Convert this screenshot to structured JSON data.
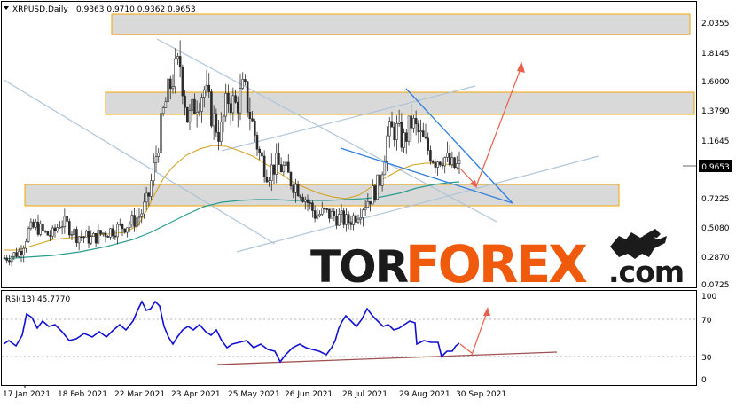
{
  "header": {
    "symbol": "XRPUSD,Daily",
    "ohlc": "0.9363 0.9710 0.9362 0.9653"
  },
  "price_axis": {
    "ticks": [
      "2.0355",
      "1.8145",
      "1.6000",
      "1.3790",
      "1.1645",
      "0.9653",
      "0.7225",
      "0.5080",
      "0.2870",
      "0.0725"
    ],
    "current_price": "0.9653"
  },
  "rsi": {
    "label": "RSI(13) 45.7770",
    "ticks": [
      "100",
      "70",
      "30",
      "0"
    ]
  },
  "dates": [
    "17 Jan 2021",
    "18 Feb 2021",
    "22 Mar 2021",
    "23 Apr 2021",
    "25 May 2021",
    "26 Jun 2021",
    "28 Jul 2021",
    "29 Aug 2021",
    "30 Sep 2021"
  ],
  "watermark": {
    "part1": "TOR",
    "part2": "FOREX",
    "part3": ".com"
  },
  "colors": {
    "bull_candle": "#2b2b2b",
    "bear_candle": "#2b2b2b",
    "ma_fast": "#d4a017",
    "ma_slow": "#2a9d8f",
    "zone_fill": "#d9d9d9",
    "zone_border": "#f0a500",
    "channel": "#b0c4d8",
    "triangle": "#2f7fe0",
    "arrow": "#e8604c",
    "rsi_line": "#1010d0",
    "rsi_support": "#a05050",
    "watermark_dark": "#1b1b1b",
    "watermark_orange": "#f05a0c"
  },
  "chart_data": {
    "type": "candlestick",
    "close_path": [
      0.28,
      0.3,
      0.33,
      0.48,
      0.52,
      0.46,
      0.45,
      0.55,
      0.52,
      0.45,
      0.44,
      0.42,
      0.46,
      0.48,
      0.5,
      0.52,
      0.55,
      0.6,
      0.72,
      1.05,
      1.4,
      1.62,
      1.74,
      1.3,
      1.45,
      1.55,
      1.35,
      1.2,
      1.48,
      1.42,
      1.55,
      1.3,
      1.05,
      0.92,
      0.98,
      0.95,
      0.85,
      0.8,
      0.7,
      0.6,
      0.62,
      0.6,
      0.58,
      0.55,
      0.6,
      0.68,
      0.75,
      0.85,
      1.2,
      1.25,
      1.15,
      1.3,
      1.2,
      1.1,
      1.02,
      1.05,
      0.96,
      0.9653
    ],
    "rsi_path": [
      40,
      45,
      85,
      78,
      70,
      72,
      66,
      62,
      60,
      64,
      68,
      72,
      58,
      55,
      88,
      92,
      74,
      60,
      64,
      58,
      66,
      70,
      62,
      48,
      44,
      40,
      42,
      44,
      36,
      38,
      30,
      42,
      40,
      38,
      44,
      42,
      38,
      36,
      40,
      48,
      70,
      82,
      66,
      60,
      64,
      58,
      48,
      46,
      44,
      40,
      42,
      45.777
    ]
  }
}
